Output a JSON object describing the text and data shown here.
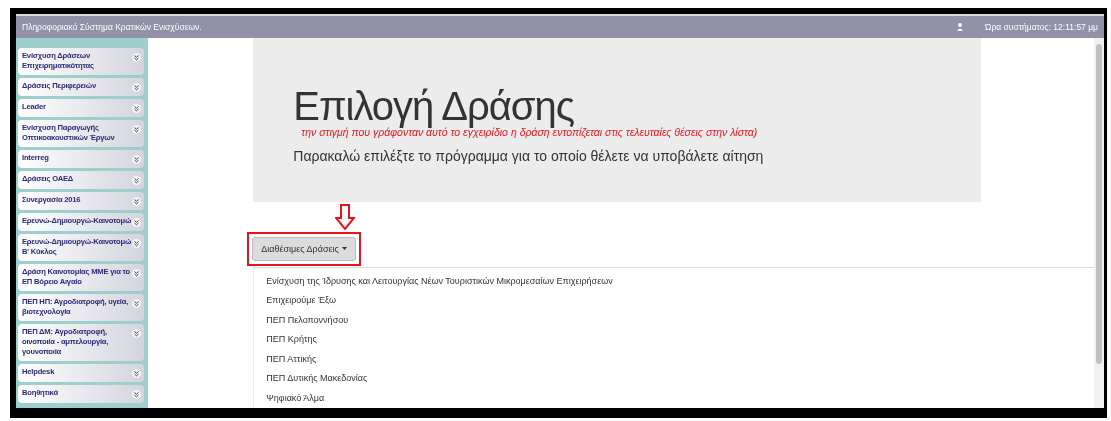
{
  "header": {
    "title": "Πληροφοριακό Σύστημα Κρατικών Ενισχύσεων.",
    "clock": "Ώρα συστήματος: 12:11:57 μμ"
  },
  "sidebar": {
    "items": [
      {
        "label": "Ενίσχυση Δράσεων Επιχειρηματικότητας"
      },
      {
        "label": "Δράσεις Περιφερειών"
      },
      {
        "label": "Leader"
      },
      {
        "label": "Ενίσχυση Παραγωγής Οπτικοακουστικών Έργων"
      },
      {
        "label": "Interreg"
      },
      {
        "label": "Δράσεις ΟΑΕΔ"
      },
      {
        "label": "Συνεργασία 2016"
      },
      {
        "label": "Ερευνώ-Δημιουργώ-Καινοτομώ"
      },
      {
        "label": "Ερευνώ-Δημιουργώ-Καινοτομώ Β' Κύκλος"
      },
      {
        "label": "Δράση Καινοτομίας ΜΜΕ για το ΕΠ Βόρειο Αιγαίο"
      },
      {
        "label": "ΠΕΠ ΗΠ: Αγροδιατροφή, υγεία, βιοτεχνολογία"
      },
      {
        "label": "ΠΕΠ ΔΜ: Αγροδιατροφή, οινοποιία - αμπελουργία, γουνοποιία"
      },
      {
        "label": "Helpdesk"
      },
      {
        "label": "Βοηθητικά"
      }
    ]
  },
  "jumbotron": {
    "heading": "Επιλογή Δράσης",
    "note": "την στιγμή που γράφονταν αυτό το εγχειρίδιο η δράση εντοπίζεται στις τελευταίες θέσεις στην λίστα)",
    "subtitle": "Παρακαλώ επιλέξτε το πρόγραμμα για το οποίο θέλετε να υποβάλετε αίτηση"
  },
  "dropdown": {
    "label": "Διαθέσιμες Δράσεις",
    "expanded": true,
    "highlighted": true,
    "items": [
      "Ενίσχυση της Ίδρυσης και Λειτουργίας Νέων Τουριστικών Μικρομεσαίων Επιχειρήσεων",
      "Επιχειρούμε Έξω",
      "ΠΕΠ Πελοποννήσου",
      "ΠΕΠ Κρήτης",
      "ΠΕΠ Αττικής",
      "ΠΕΠ Δυτικής Μακεδονίας",
      "Ψηφιακό Άλμα"
    ]
  }
}
